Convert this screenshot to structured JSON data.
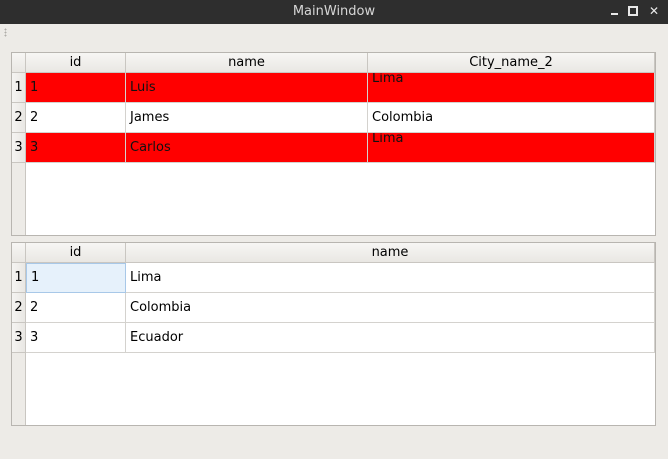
{
  "window": {
    "title": "MainWindow"
  },
  "colors": {
    "highlight_row": "#ff0000",
    "titlebar": "#2e2e2e",
    "window_bg": "#edebe7"
  },
  "table1": {
    "columns": [
      "id",
      "name",
      "City_name_2"
    ],
    "rows": [
      {
        "header": "1",
        "cells": [
          "1",
          "Luis",
          "Lima"
        ],
        "highlighted": true
      },
      {
        "header": "2",
        "cells": [
          "2",
          "James",
          "Colombia"
        ],
        "highlighted": false
      },
      {
        "header": "3",
        "cells": [
          "3",
          "Carlos",
          "Lima"
        ],
        "highlighted": true
      }
    ]
  },
  "table2": {
    "columns": [
      "id",
      "name"
    ],
    "rows": [
      {
        "header": "1",
        "cells": [
          "1",
          "Lima"
        ],
        "selected_cell": 0
      },
      {
        "header": "2",
        "cells": [
          "2",
          "Colombia"
        ]
      },
      {
        "header": "3",
        "cells": [
          "3",
          "Ecuador"
        ]
      }
    ]
  }
}
